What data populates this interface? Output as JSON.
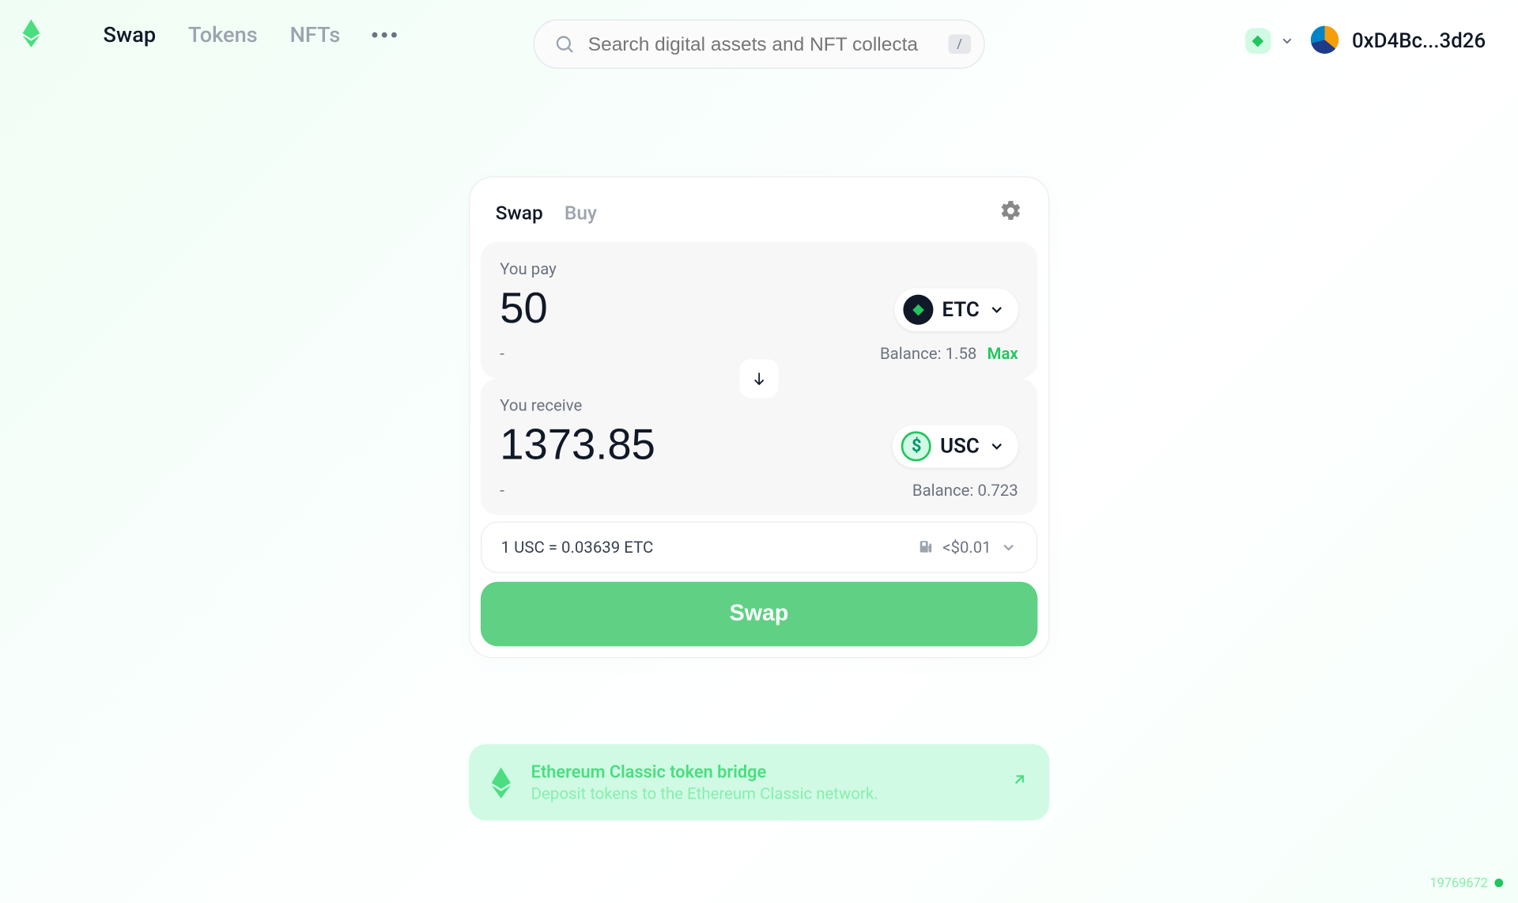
{
  "nav": {
    "items": [
      "Swap",
      "Tokens",
      "NFTs"
    ],
    "active_index": 0
  },
  "search": {
    "placeholder": "Search digital assets and NFT collecta",
    "shortcut": "/"
  },
  "account": {
    "address_short": "0xD4Bc...3d26"
  },
  "card": {
    "tabs": [
      "Swap",
      "Buy"
    ],
    "active_tab_index": 0,
    "pay": {
      "label": "You pay",
      "amount": "50",
      "fiat": "-",
      "token_symbol": "ETC",
      "balance_label": "Balance: 1.58",
      "max_label": "Max"
    },
    "receive": {
      "label": "You receive",
      "amount": "1373.85",
      "fiat": "-",
      "token_symbol": "USC",
      "balance_label": "Balance: 0.723"
    },
    "rate_text": "1 USC = 0.03639 ETC",
    "gas_text": "<$0.01",
    "cta": "Swap"
  },
  "bridge": {
    "title": "Ethereum Classic token bridge",
    "subtitle": "Deposit tokens to the Ethereum Classic network."
  },
  "status": {
    "block": "19769672"
  }
}
